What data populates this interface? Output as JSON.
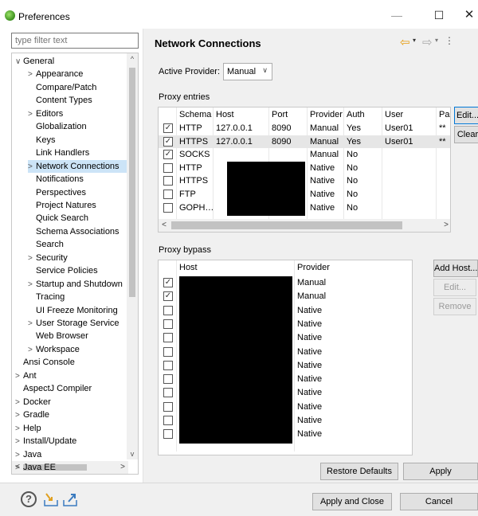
{
  "window": {
    "title": "Preferences",
    "min": "—",
    "max": "☐",
    "close": "✕"
  },
  "sidebar": {
    "filter_placeholder": "type filter text",
    "items": [
      {
        "label": "General",
        "arrow": "∨",
        "level": 0
      },
      {
        "label": "Appearance",
        "arrow": ">",
        "level": 1
      },
      {
        "label": "Compare/Patch",
        "arrow": "",
        "level": 1
      },
      {
        "label": "Content Types",
        "arrow": "",
        "level": 1
      },
      {
        "label": "Editors",
        "arrow": ">",
        "level": 1
      },
      {
        "label": "Globalization",
        "arrow": "",
        "level": 1
      },
      {
        "label": "Keys",
        "arrow": "",
        "level": 1
      },
      {
        "label": "Link Handlers",
        "arrow": "",
        "level": 1
      },
      {
        "label": "Network Connections",
        "arrow": ">",
        "level": 1,
        "selected": true
      },
      {
        "label": "Notifications",
        "arrow": "",
        "level": 1
      },
      {
        "label": "Perspectives",
        "arrow": "",
        "level": 1
      },
      {
        "label": "Project Natures",
        "arrow": "",
        "level": 1
      },
      {
        "label": "Quick Search",
        "arrow": "",
        "level": 1
      },
      {
        "label": "Schema Associations",
        "arrow": "",
        "level": 1
      },
      {
        "label": "Search",
        "arrow": "",
        "level": 1
      },
      {
        "label": "Security",
        "arrow": ">",
        "level": 1
      },
      {
        "label": "Service Policies",
        "arrow": "",
        "level": 1
      },
      {
        "label": "Startup and Shutdown",
        "arrow": ">",
        "level": 1
      },
      {
        "label": "Tracing",
        "arrow": "",
        "level": 1
      },
      {
        "label": "UI Freeze Monitoring",
        "arrow": "",
        "level": 1
      },
      {
        "label": "User Storage Service",
        "arrow": ">",
        "level": 1
      },
      {
        "label": "Web Browser",
        "arrow": "",
        "level": 1
      },
      {
        "label": "Workspace",
        "arrow": ">",
        "level": 1
      },
      {
        "label": "Ansi Console",
        "arrow": "",
        "level": 0
      },
      {
        "label": "Ant",
        "arrow": ">",
        "level": 0
      },
      {
        "label": "AspectJ Compiler",
        "arrow": "",
        "level": 0
      },
      {
        "label": "Docker",
        "arrow": ">",
        "level": 0
      },
      {
        "label": "Gradle",
        "arrow": ">",
        "level": 0
      },
      {
        "label": "Help",
        "arrow": ">",
        "level": 0
      },
      {
        "label": "Install/Update",
        "arrow": ">",
        "level": 0
      },
      {
        "label": "Java",
        "arrow": ">",
        "level": 0
      },
      {
        "label": "Java EE",
        "arrow": ">",
        "level": 0
      }
    ]
  },
  "page": {
    "title": "Network Connections",
    "provider_label": "Active Provider:",
    "provider_value": "Manual",
    "proxy_entries_label": "Proxy entries",
    "proxy_bypass_label": "Proxy bypass"
  },
  "proxy_entries": {
    "headers": [
      "Schema",
      "Host",
      "Port",
      "Provider",
      "Auth",
      "User",
      "Pa"
    ],
    "rows": [
      {
        "checked": true,
        "schema": "HTTP",
        "host": "127.0.0.1",
        "port": "8090",
        "provider": "Manual",
        "auth": "Yes",
        "user": "User01",
        "pass": "**"
      },
      {
        "checked": true,
        "schema": "HTTPS",
        "host": "127.0.0.1",
        "port": "8090",
        "provider": "Manual",
        "auth": "Yes",
        "user": "User01",
        "pass": "**"
      },
      {
        "checked": true,
        "schema": "SOCKS",
        "host": "",
        "port": "",
        "provider": "Manual",
        "auth": "No",
        "user": "",
        "pass": ""
      },
      {
        "checked": false,
        "schema": "HTTP",
        "host": "",
        "port": "",
        "provider": "Native",
        "auth": "No",
        "user": "",
        "pass": ""
      },
      {
        "checked": false,
        "schema": "HTTPS",
        "host": "",
        "port": "",
        "provider": "Native",
        "auth": "No",
        "user": "",
        "pass": ""
      },
      {
        "checked": false,
        "schema": "FTP",
        "host": "",
        "port": "",
        "provider": "Native",
        "auth": "No",
        "user": "",
        "pass": ""
      },
      {
        "checked": false,
        "schema": "GOPH…",
        "host": "",
        "port": "",
        "provider": "Native",
        "auth": "No",
        "user": "",
        "pass": ""
      }
    ],
    "buttons": {
      "edit": "Edit...",
      "clear": "Clear"
    }
  },
  "proxy_bypass": {
    "headers": [
      "Host",
      "Provider"
    ],
    "rows": [
      {
        "checked": true,
        "provider": "Manual"
      },
      {
        "checked": true,
        "provider": "Manual"
      },
      {
        "checked": false,
        "provider": "Native"
      },
      {
        "checked": false,
        "provider": "Native"
      },
      {
        "checked": false,
        "provider": "Native"
      },
      {
        "checked": false,
        "provider": "Native"
      },
      {
        "checked": false,
        "provider": "Native"
      },
      {
        "checked": false,
        "provider": "Native"
      },
      {
        "checked": false,
        "provider": "Native"
      },
      {
        "checked": false,
        "provider": "Native"
      },
      {
        "checked": false,
        "provider": "Native"
      },
      {
        "checked": false,
        "provider": "Native"
      }
    ],
    "buttons": {
      "add_host": "Add Host...",
      "edit": "Edit...",
      "remove": "Remove"
    }
  },
  "buttons": {
    "restore_defaults": "Restore Defaults",
    "apply": "Apply",
    "apply_and_close": "Apply and Close",
    "cancel": "Cancel"
  },
  "icons": {
    "help": "?",
    "back": "⇦",
    "forward": "⇨",
    "dropdown": "▾",
    "menu": "⋮"
  },
  "colors": {
    "selection": "#cce4f7",
    "row_selected": "#e6e6e6",
    "nav_back": "#e69c0f"
  }
}
